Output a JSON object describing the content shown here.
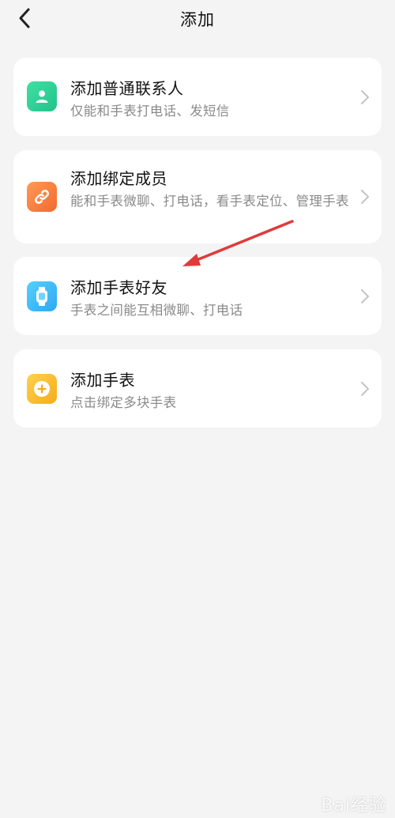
{
  "header": {
    "title": "添加",
    "back_icon": "chevron-left-icon"
  },
  "items": [
    {
      "title": "添加普通联系人",
      "subtitle": "仅能和手表打电话、发短信",
      "icon": "person-icon",
      "icon_color": "#34d399"
    },
    {
      "title": "添加绑定成员",
      "subtitle": "能和手表微聊、打电话，看手表定位、管理手表",
      "icon": "link-icon",
      "icon_color": "#fb7a3c"
    },
    {
      "title": "添加手表好友",
      "subtitle": "手表之间能互相微聊、打电话",
      "icon": "watch-icon",
      "icon_color": "#38bdf8"
    },
    {
      "title": "添加手表",
      "subtitle": "点击绑定多块手表",
      "icon": "plus-circle-icon",
      "icon_color": "#fbbf24"
    }
  ],
  "annotation": {
    "arrow_color": "#e03a3a"
  },
  "watermark": {
    "text": "Bai经验"
  }
}
